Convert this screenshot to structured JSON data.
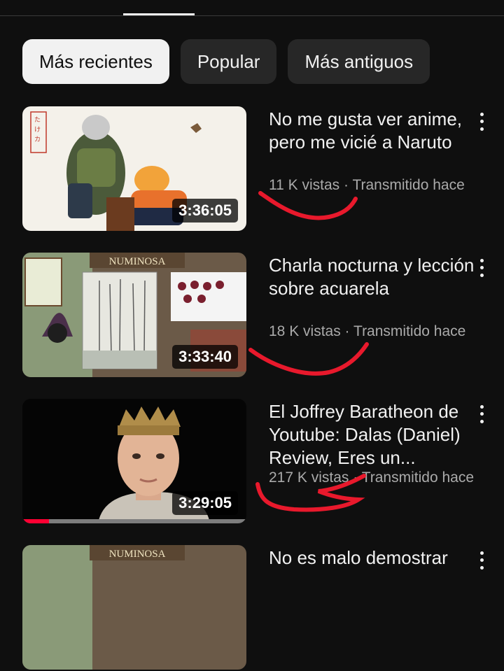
{
  "filters": {
    "chips": [
      {
        "label": "Más recientes",
        "selected": true
      },
      {
        "label": "Popular",
        "selected": false
      },
      {
        "label": "Más antiguos",
        "selected": false
      }
    ]
  },
  "videos": [
    {
      "title": "No me gusta ver anime, pero me vicié a Naruto",
      "views": "11 K vistas",
      "separator": " · ",
      "status": "Transmitido hace",
      "duration": "3:36:05",
      "thumbnail": "naruto-kakashi-artwork"
    },
    {
      "title": "Charla nocturna y lección sobre acuarela",
      "views": "18 K vistas",
      "separator": " · ",
      "status": "Transmitido hace",
      "duration": "3:33:40",
      "thumbnail": "numinosa-watercolor-desk",
      "thumb_banner": "NUMINOSA"
    },
    {
      "title": "El Joffrey Baratheon de Youtube: Dalas (Daniel) Review, Eres un...",
      "views": "217 K vistas",
      "separator": " · ",
      "status": "Transmitido hace",
      "duration": "3:29:05",
      "thumbnail": "crowned-boy-portrait",
      "watched_progress": 0.12
    },
    {
      "title": "No es malo demostrar",
      "thumbnail": "numinosa-watercolor-desk",
      "thumb_banner": "NUMINOSA"
    }
  ],
  "colors": {
    "background": "#0f0f0f",
    "chip": "#272727",
    "chip_selected": "#f1f1f1",
    "meta_text": "#aaaaaa",
    "progress": "#ff0033",
    "annotation": "#e8192c"
  },
  "icons": {
    "more": "more-vert-icon"
  }
}
